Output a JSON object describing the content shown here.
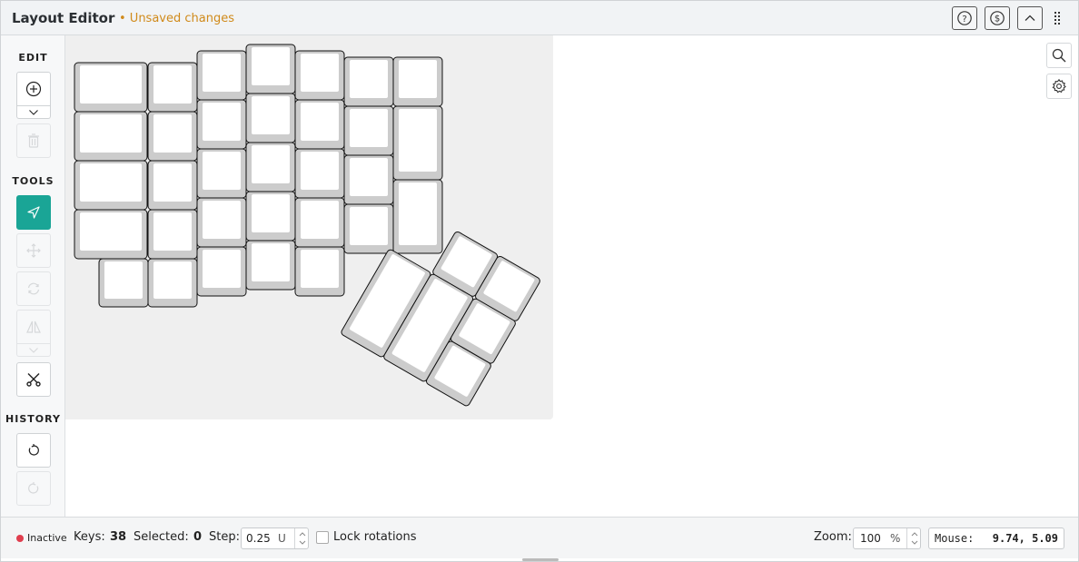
{
  "header": {
    "title": "Layout Editor",
    "unsaved": "• Unsaved changes",
    "buttons": [
      {
        "name": "help-button",
        "icon": "question-circle-icon"
      },
      {
        "name": "donate-button",
        "icon": "dollar-circle-icon"
      },
      {
        "name": "collapse-button",
        "icon": "chevron-up-icon"
      },
      {
        "name": "drag-handle",
        "icon": "grip-vertical-icon"
      }
    ]
  },
  "sidebar": {
    "edit_label": "EDIT",
    "tools_label": "TOOLS",
    "history_label": "HISTORY",
    "edit_buttons": [
      {
        "name": "add-key-button",
        "icon": "plus-circle-icon",
        "enabled": true
      },
      {
        "name": "delete-key-button",
        "icon": "trash-icon",
        "enabled": false
      }
    ],
    "tool_buttons": [
      {
        "name": "select-tool-button",
        "icon": "cursor-arrow-icon",
        "active": true
      },
      {
        "name": "move-tool-button",
        "icon": "move-arrows-icon",
        "enabled": false
      },
      {
        "name": "rotate-tool-button",
        "icon": "rotate-icon",
        "enabled": false
      },
      {
        "name": "mirror-tool-button",
        "icon": "mirror-icon",
        "enabled": false
      },
      {
        "name": "scissors-tool-button",
        "icon": "scissors-icon",
        "enabled": true
      }
    ],
    "history_buttons": [
      {
        "name": "undo-button",
        "icon": "undo-icon",
        "enabled": true
      },
      {
        "name": "redo-button",
        "icon": "redo-icon",
        "enabled": false
      }
    ]
  },
  "canvas": {
    "keycap_color": "#ffffff",
    "keycap_side_color": "#cccccc",
    "background": "#efefef"
  },
  "right_tools": [
    {
      "name": "search-button",
      "icon": "search-icon"
    },
    {
      "name": "settings-button",
      "icon": "gear-icon"
    }
  ],
  "status": {
    "state": "Inactive",
    "state_color": "#e03e4e",
    "keys_label": "Keys:",
    "keys_value": "38",
    "selected_label": "Selected:",
    "selected_value": "0",
    "step_label": "Step:",
    "step_value": "0.25",
    "step_unit": "U",
    "lock_label": "Lock rotations",
    "lock_checked": false,
    "zoom_label": "Zoom:",
    "zoom_value": "100",
    "zoom_unit": "%",
    "mouse_label": "Mouse:",
    "mouse_value": "9.74, 5.09"
  }
}
